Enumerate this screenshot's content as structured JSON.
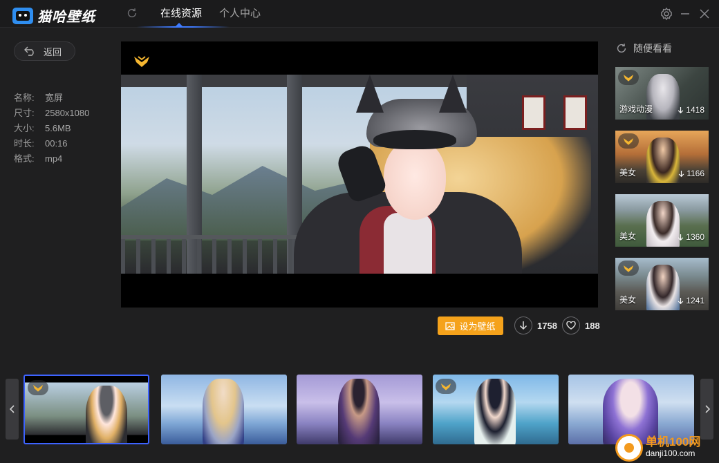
{
  "app": {
    "title": "猫哈壁纸"
  },
  "tabs": [
    {
      "label": "在线资源",
      "active": true
    },
    {
      "label": "个人中心",
      "active": false
    }
  ],
  "back": {
    "label": "返回"
  },
  "info": [
    {
      "key": "名称:",
      "value": "宽屏"
    },
    {
      "key": "尺寸:",
      "value": "2580x1080"
    },
    {
      "key": "大小:",
      "value": "5.6MB"
    },
    {
      "key": "时长:",
      "value": "00:16"
    },
    {
      "key": "格式:",
      "value": "mp4"
    }
  ],
  "actions": {
    "set_wallpaper_label": "设为壁纸",
    "downloads": "1758",
    "likes": "188"
  },
  "random": {
    "title": "随便看看",
    "items": [
      {
        "label": "游戏动漫",
        "count": "1418"
      },
      {
        "label": "美女",
        "count": "1166"
      },
      {
        "label": "美女",
        "count": "1360"
      },
      {
        "label": "美女",
        "count": "1241"
      }
    ]
  },
  "watermark": {
    "title": "单机100网",
    "url": "danji100.com"
  },
  "colors": {
    "accent": "#3f7bff",
    "button": "#f5a21b",
    "badge": "#f5b630"
  }
}
